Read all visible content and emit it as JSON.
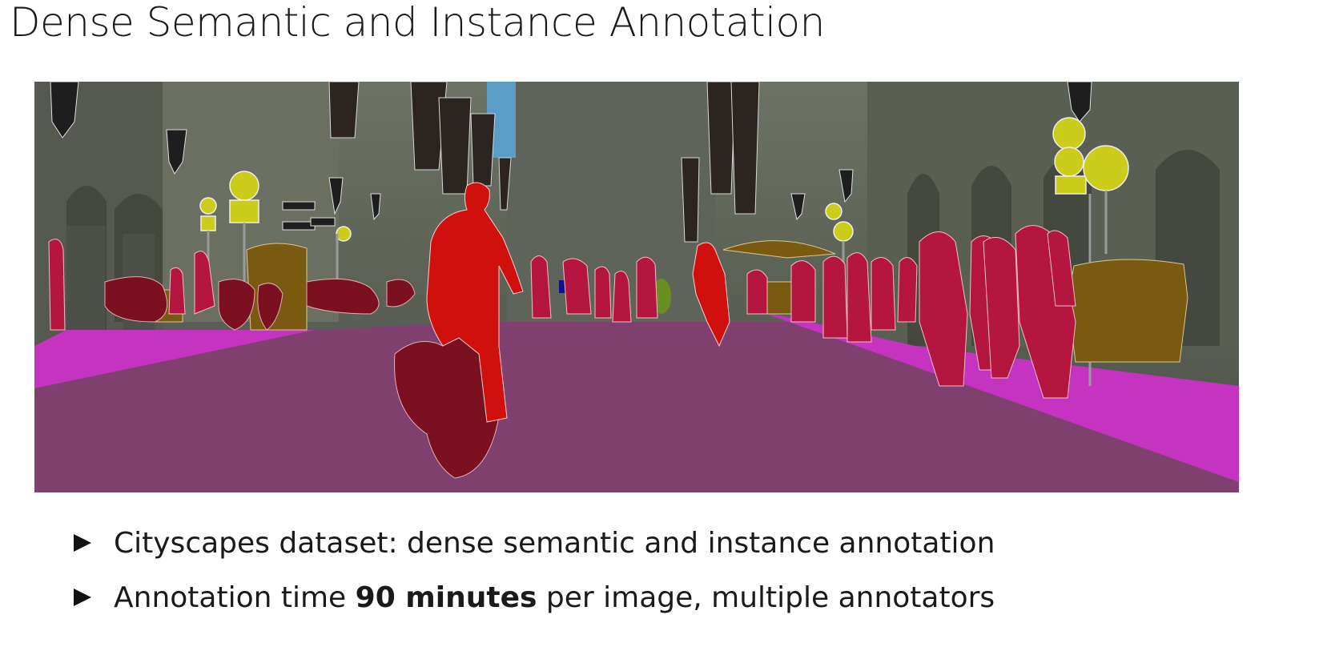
{
  "title": "Dense Semantic and Instance Annotation",
  "bullets": [
    {
      "text": "Cityscapes dataset: dense semantic and instance annotation"
    },
    {
      "prefix": "Annotation time ",
      "emphasis": "90 minutes",
      "suffix": " per image, multiple annotators"
    }
  ],
  "colors": {
    "road": "#80406f",
    "sidewalk": "#c534c0",
    "person": "#b41640",
    "rider": "#d0100c",
    "bicycle": "#7a1020",
    "traffic_sign": "#cccc1a",
    "traffic_light": "#1e1e1e",
    "vegetation": "#6b8e23",
    "sky": "#5a9ec8",
    "car": "#10108e",
    "static_object": "#7a5a10",
    "building": "#5d6358"
  }
}
